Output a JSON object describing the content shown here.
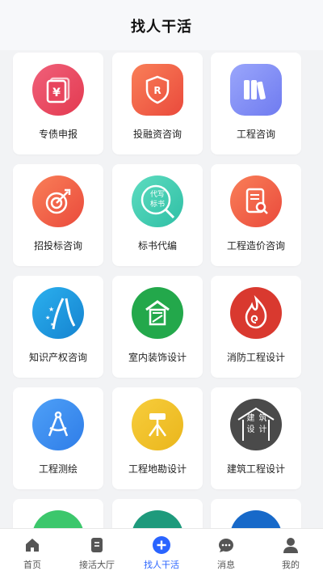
{
  "header": {
    "title": "找人干活"
  },
  "services": [
    {
      "label": "专债申报",
      "icon": "yuan-document-icon",
      "color": "#e8455e"
    },
    {
      "label": "投融资咨询",
      "icon": "shield-r-icon",
      "color": "#ef5a4d"
    },
    {
      "label": "工程咨询",
      "icon": "books-icon",
      "color": "#7f8cf5"
    },
    {
      "label": "招投标咨询",
      "icon": "target-arrow-icon",
      "color": "#ef5a4d"
    },
    {
      "label": "标书代编",
      "icon": "magnifier-tag-icon",
      "color": "#40c9b0",
      "icon_text": [
        "代写",
        "标书"
      ]
    },
    {
      "label": "工程造价咨询",
      "icon": "invoice-search-icon",
      "color": "#ef5a4d"
    },
    {
      "label": "知识产权咨询",
      "icon": "road-stars-icon",
      "color": "#1f9be0"
    },
    {
      "label": "室内装饰设计",
      "icon": "house-frame-icon",
      "color": "#23a84b"
    },
    {
      "label": "消防工程设计",
      "icon": "flame-icon",
      "color": "#d9392f"
    },
    {
      "label": "工程测绘",
      "icon": "compass-icon",
      "color": "#3d8ff0"
    },
    {
      "label": "工程地勘设计",
      "icon": "survey-tripod-icon",
      "color": "#f0c028"
    },
    {
      "label": "建筑工程设计",
      "icon": "building-house-icon",
      "color": "#4a4a4a",
      "icon_text": [
        "建",
        "筑",
        "设",
        "计"
      ]
    },
    {
      "label": "",
      "icon": "green-app-icon",
      "color": "#3cc76c"
    },
    {
      "label": "",
      "icon": "teal-swirl-icon",
      "color": "#1e9a7c"
    },
    {
      "label": "",
      "icon": "blue-building-icon",
      "color": "#1769c9"
    }
  ],
  "tabbar": [
    {
      "label": "首页",
      "icon": "home-icon"
    },
    {
      "label": "接活大厅",
      "icon": "task-hall-icon"
    },
    {
      "label": "找人干活",
      "icon": "plus-circle-icon",
      "active": true,
      "active_color": "#2a64ff"
    },
    {
      "label": "消息",
      "icon": "chat-bubble-icon"
    },
    {
      "label": "我的",
      "icon": "user-icon"
    }
  ]
}
